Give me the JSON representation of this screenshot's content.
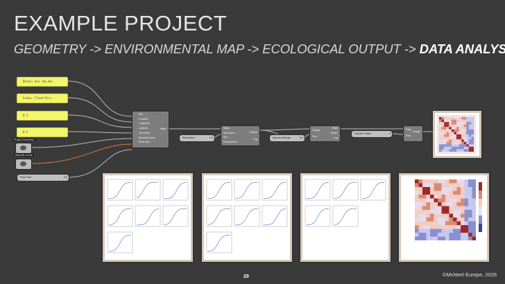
{
  "title": "EXAMPLE PROJECT",
  "subtitle": {
    "step1": "GEOMETRY",
    "step2": "ENVIRONMENTAL MAP",
    "step3": "ECOLOGICAL OUTPUT",
    "step4": "DATA ANALYSIS",
    "arrow": " -> "
  },
  "inputs": {
    "panels": [
      "Detail Geo (mm,mm)",
      "Scuba, Flood Rtrs...",
      "0.1",
      "0.5"
    ],
    "param_labels": [
      "Project Geometry",
      "Biophilic Areas"
    ],
    "slider": {
      "label": "Pixel Size",
      "value": "0.6"
    }
  },
  "component1": {
    "inputs": [
      "Site",
      "Location",
      "Longitude",
      "Latitude",
      "Geometry",
      "Biophilic Areas",
      "Pixel Size"
    ],
    "outputs": [
      "Maps"
    ]
  },
  "slider2": {
    "label": "Resolution",
    "value": "1.0"
  },
  "component2": {
    "inputs": [
      "Maps",
      "Resolution",
      "Run",
      "Environment"
    ],
    "outputs": [
      "Output",
      "Log"
    ]
  },
  "slider3": {
    "label": "Species Range",
    "value": "0.4"
  },
  "component3": {
    "inputs": [
      "Output",
      "Run"
    ],
    "outputs": [
      "Stats",
      "Vector",
      "Log"
    ]
  },
  "slider4": {
    "label": "Number Slider",
    "value": "1"
  },
  "component4": {
    "inputs": [
      "Data",
      "Run"
    ],
    "outputs": [
      "Image"
    ]
  },
  "colors": {
    "background": "#3a3a3a",
    "panel": "#f3f56a",
    "wire_orange": "#d9783a",
    "wire_gray": "#bdbdbd"
  },
  "page_number": "29",
  "copyright": "©McNeel Europe, 2026"
}
